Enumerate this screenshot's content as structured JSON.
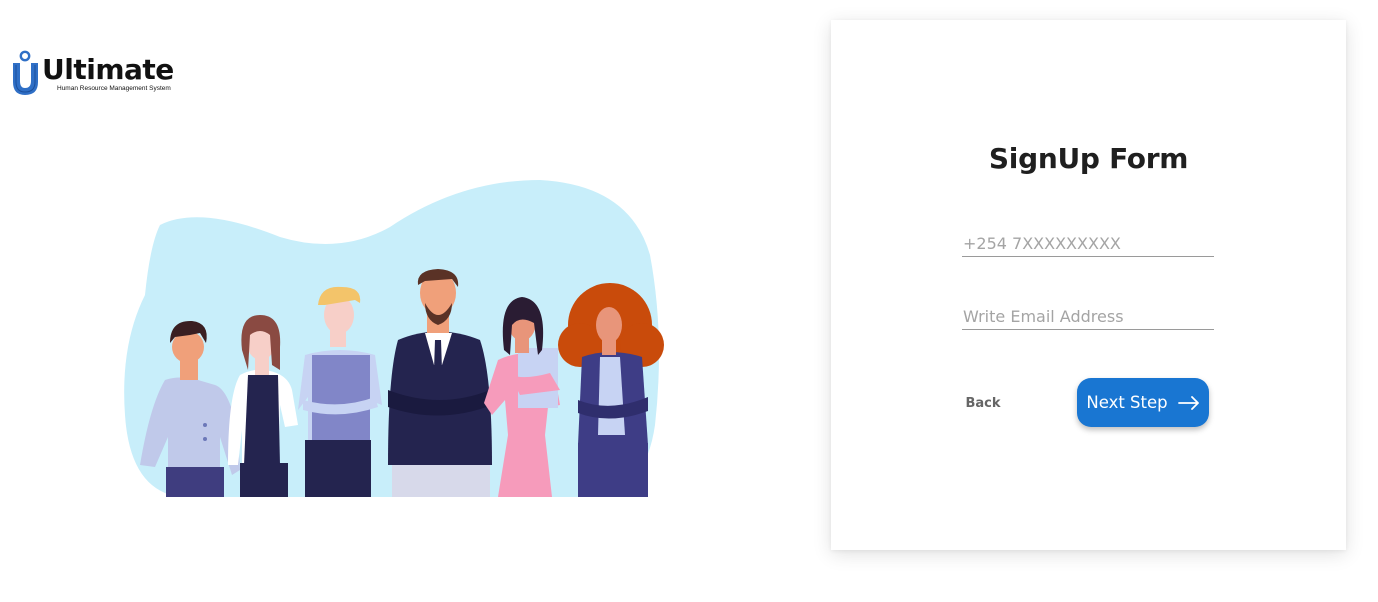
{
  "brand": {
    "name": "Ultimate",
    "tagline": "Human Resource Management System",
    "logo_icon": "u-pin-logo-icon",
    "accent_color": "#2f6fc6"
  },
  "illustration": {
    "icon": "team-people-illustration",
    "bg_color": "#c8eefa"
  },
  "form": {
    "title": "SignUp Form",
    "phone_placeholder": "+254 7XXXXXXXXX",
    "email_placeholder": "Write Email Address",
    "back_label": "Back",
    "next_label": "Next Step",
    "next_icon": "arrow-right-icon",
    "button_color": "#1976d2"
  }
}
